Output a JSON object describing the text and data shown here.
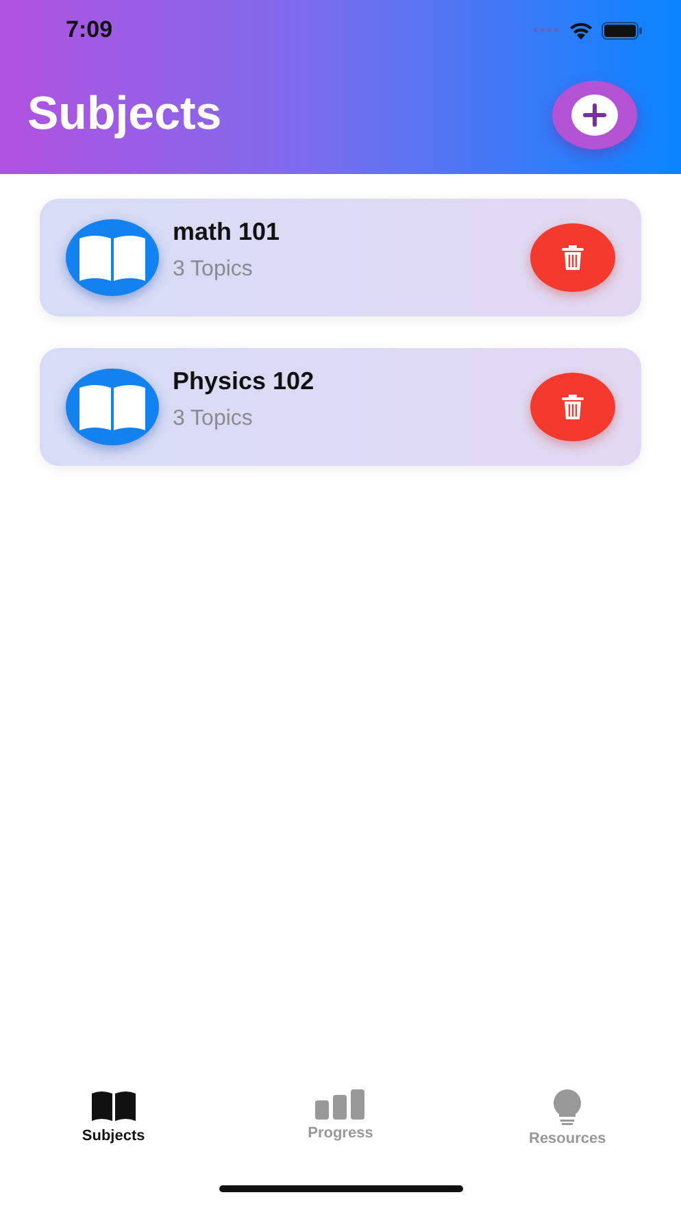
{
  "status_bar": {
    "time": "7:09"
  },
  "header": {
    "title": "Subjects"
  },
  "subjects": [
    {
      "name": "math 101",
      "topics": "3 Topics"
    },
    {
      "name": "Physics 102",
      "topics": "3 Topics"
    }
  ],
  "tabs": [
    {
      "kind": "book",
      "label": "Subjects",
      "selected": true
    },
    {
      "kind": "bars",
      "label": "Progress",
      "selected": false
    },
    {
      "kind": "bulb",
      "label": "Resources",
      "selected": false
    }
  ]
}
